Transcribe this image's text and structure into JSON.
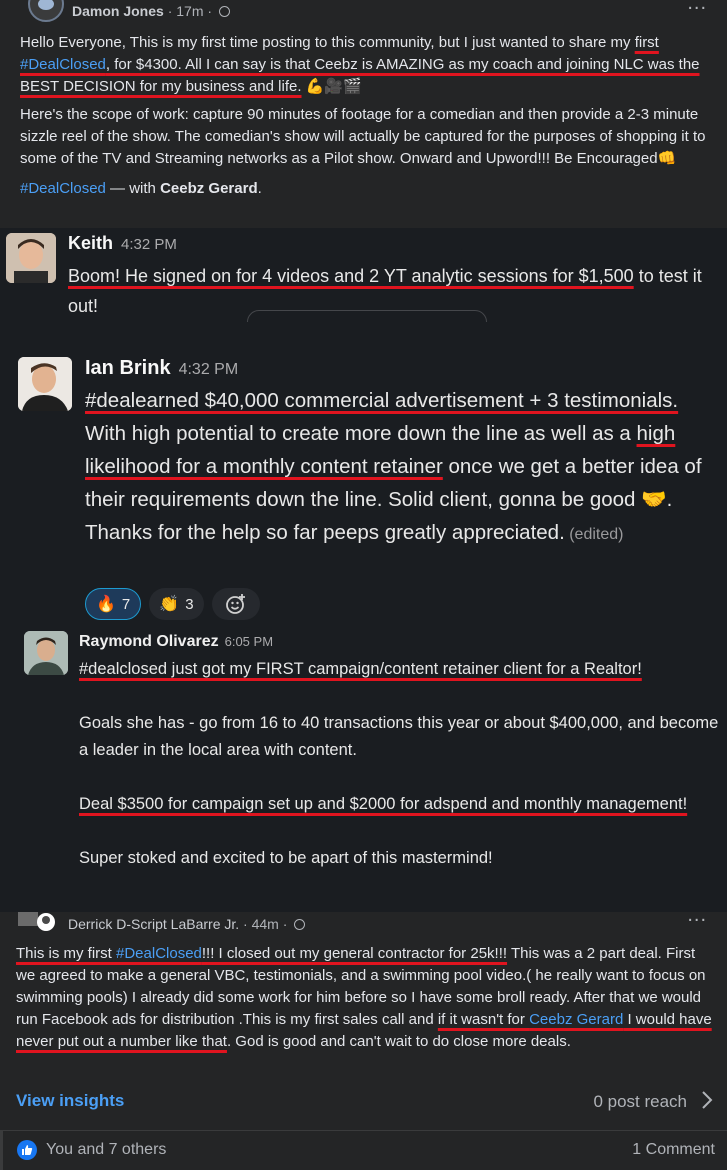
{
  "post1": {
    "author": "Damon Jones",
    "time": "17m",
    "separator": " · ",
    "more": "...",
    "p1_a": "Hello Everyone, This is my first time posting to this community, but I just wanted to share my ",
    "p1_b": "first ",
    "p1_tag": "#DealClosed",
    "p1_c": ", for $4300. All I can say is that Ceebz is AMAZING as my coach and joining NLC was the BEST DECISION for my business and life.",
    "p1_emoji": " 💪🎥🎬",
    "p2": "Here's the scope of work: capture 90 minutes of footage for a comedian and then provide a 2-3 minute sizzle reel of the show. The comedian's show will actually be captured for the purposes of shopping it to some of the TV and Streaming networks as a Pilot show. Onward and Upword!!! Be Encouraged👊",
    "tag": "#DealClosed",
    "with_text": " — with ",
    "with_name": "Ceebz Gerard",
    "with_end": "."
  },
  "keith": {
    "name": "Keith",
    "time": "4:32 PM",
    "text_ul": "Boom! He signed on for 4 videos and 2 YT analytic sessions for $1,500",
    "text_rest": " to test it out!"
  },
  "ian": {
    "name": "Ian Brink",
    "time": "4:32 PM",
    "t1": "#dealearned $40,000 commercial advertisement + 3",
    "t2": " testimonials.",
    "t3": " With high potential to create more down the line as well as a ",
    "t4": "high likelihood for a monthly content retainer",
    "t5": " once we get a better idea of their requirements down the line. Solid client, gonna be good 🤝. Thanks for the help so far peeps greatly appreciated.",
    "edited": " (edited)",
    "reactions": [
      {
        "emoji": "🔥",
        "count": "7"
      },
      {
        "emoji": "👏",
        "count": "3"
      }
    ],
    "add_reaction": "☺+"
  },
  "raymond": {
    "name": "Raymond Olivarez",
    "time": "6:05 PM",
    "line1": "#dealclosed just got my FIRST campaign/content retainer client for a Realtor!",
    "line2": "Goals she has - go from 16 to 40 transactions this year or about $400,000, and become a leader in the local area with content.",
    "line3": "Deal $3500 for campaign set up and $2000 for adspend and monthly management!",
    "line4": "Super stoked and excited to be apart of this mastermind!"
  },
  "post2": {
    "author": "Derrick D-Script LaBarre Jr.",
    "time": "44m",
    "separator": " · ",
    "more": "...",
    "b1": "This is my first ",
    "b1_tag": "#DealClosed",
    "b2": "!!! I closed out my general contractor for 25k!!!",
    "b3": " This was a 2 part deal. First we agreed to make a general VBC, testimonials, and a swimming pool video.( he really want to focus on swimming pools) I already did some work for him before so I have some broll ready. After that we would run Facebook ads for distribution  .This is my first sales call and ",
    "b4": "if it wasn't for ",
    "b4_tag": "Ceebz Gerard",
    "b5": " I would have never put out a number like that",
    "b6": ". God is good and can't wait to do close more deals.",
    "insights": "View insights",
    "reach": "0 post reach",
    "likes": "You and 7 others",
    "comments": "1 Comment"
  },
  "colors": {
    "underline": "#e0141f",
    "link": "#4b9ff5",
    "fb_bg": "#242526",
    "slack_bg": "#1a1d21"
  }
}
